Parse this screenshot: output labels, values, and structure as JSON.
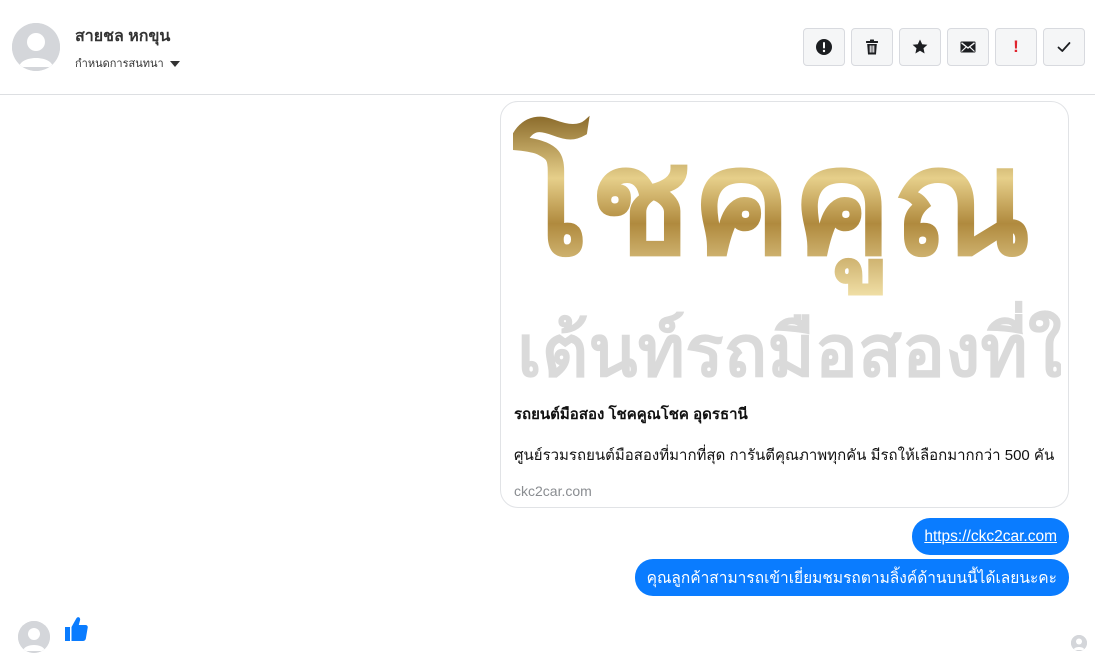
{
  "header": {
    "contact_name": "สายชล หกขุน",
    "conversation_setting": "กำหนดการสนทนา",
    "avatar_icon": "user-avatar-icon",
    "toolbar": [
      {
        "name": "report-button",
        "icon": "alert-circle-icon"
      },
      {
        "name": "delete-button",
        "icon": "trash-icon"
      },
      {
        "name": "star-button",
        "icon": "star-icon"
      },
      {
        "name": "mark-unread-button",
        "icon": "envelope-icon"
      },
      {
        "name": "mark-important-button",
        "icon": "exclamation-icon",
        "label": "!",
        "color": "#e0242e"
      },
      {
        "name": "mark-done-button",
        "icon": "checkmark-icon"
      }
    ]
  },
  "card": {
    "image_logo_line1": "โชคคูณ",
    "image_logo_line2": "เต้นท์รถมือสองที่ใ",
    "title": "รถยนต์มือสอง โชคคูณโชค อุดรธานี",
    "description": "ศูนย์รวมรถยนต์มือสองที่มากที่สุด การันตีคุณภาพทุกคัน มีรถให้เลือกมากกว่า 500 คัน",
    "domain": "ckc2car.com"
  },
  "messages": [
    {
      "type": "link",
      "text": "https://ckc2car.com"
    },
    {
      "type": "text",
      "text": "คุณลูกค้าสามารถเข้าเยี่ยมชมรถตามลิ้งค์ด้านบนนี้ได้เลยนะคะ"
    }
  ],
  "footer": {
    "reaction_icon": "thumbs-up-icon",
    "colors": {
      "accent": "#0a7cff",
      "gold": "#c9a24a"
    }
  }
}
